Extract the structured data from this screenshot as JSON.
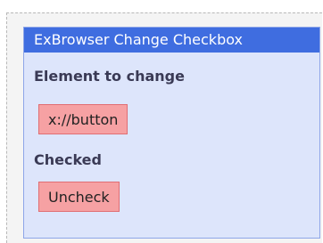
{
  "block": {
    "title": "ExBrowser Change Checkbox",
    "fields": [
      {
        "label": "Element to change",
        "value": "x://button"
      },
      {
        "label": "Checked",
        "value": "Uncheck"
      }
    ]
  },
  "colors": {
    "header": "#3f6de0",
    "block_background": "#dde5fb",
    "value_fill": "#f6a1a3",
    "value_border": "#e06e73"
  }
}
